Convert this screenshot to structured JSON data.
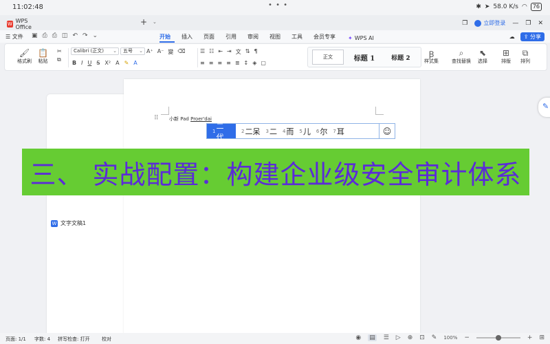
{
  "status": {
    "time": "11:02:48",
    "dots": "• • •",
    "network": "58.0 K/s",
    "battery": "76"
  },
  "tabs": [
    {
      "label": "WPS Office"
    },
    {
      "label": "文字文稿1"
    }
  ],
  "tab_plus": "+",
  "header": {
    "login_label": "立即登录"
  },
  "menubar": {
    "file_label": "文件",
    "tabs": [
      "开始",
      "插入",
      "页面",
      "引用",
      "审阅",
      "视图",
      "工具",
      "会员专享"
    ],
    "wps_ai_label": "WPS AI",
    "share_label": "分享"
  },
  "ribbon": {
    "format_painter": "格式刷",
    "paste": "粘贴",
    "font_name": "Calibri (正文)",
    "font_size": "五号",
    "styles": [
      {
        "label": "正文"
      },
      {
        "label": "标题  1"
      },
      {
        "label": "标题  2"
      }
    ],
    "style_set": "样式集",
    "find_replace": "查找替换",
    "select": "选择",
    "layout": "排版",
    "arrange": "排列"
  },
  "document": {
    "typed_prefix": "小新 Pad ",
    "composition": "Proer'dai"
  },
  "ime": {
    "candidates": [
      {
        "num": "1",
        "text": "二代"
      },
      {
        "num": "2",
        "text": "二呆"
      },
      {
        "num": "3",
        "text": "二"
      },
      {
        "num": "4",
        "text": "而"
      },
      {
        "num": "5",
        "text": "儿"
      },
      {
        "num": "6",
        "text": "尔"
      },
      {
        "num": "7",
        "text": "耳"
      }
    ],
    "emoji": "☺"
  },
  "banner": {
    "text": "三、 实战配置：构建企业级安全审计体系"
  },
  "statusbar": {
    "page": "页面: 1/1",
    "words": "字数: 4",
    "spellcheck": "拼写检查: 打开",
    "proofread": "校对",
    "zoom": "100%"
  },
  "colors": {
    "accent": "#2f6de8",
    "banner_bg": "#66cc33",
    "banner_text": "#5b2bd8"
  }
}
